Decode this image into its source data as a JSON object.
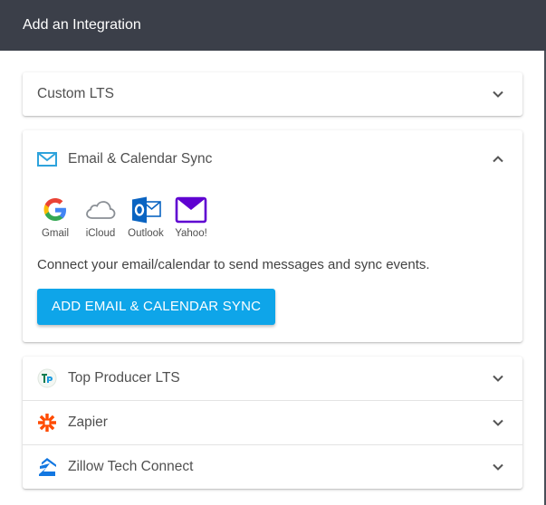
{
  "dialog": {
    "title": "Add an Integration"
  },
  "panels": {
    "custom": {
      "label": "Custom LTS"
    },
    "email": {
      "label": "Email & Calendar Sync",
      "providers": [
        {
          "name": "Gmail",
          "icon": "gmail-icon"
        },
        {
          "name": "iCloud",
          "icon": "icloud-icon"
        },
        {
          "name": "Outlook",
          "icon": "outlook-icon"
        },
        {
          "name": "Yahoo!",
          "icon": "yahoo-icon"
        }
      ],
      "description": "Connect your email/calendar to send messages and sync events.",
      "button_label": "ADD EMAIL & CALENDAR SYNC"
    },
    "top_producer": {
      "label": "Top Producer LTS"
    },
    "zapier": {
      "label": "Zapier"
    },
    "zillow": {
      "label": "Zillow Tech Connect"
    }
  },
  "colors": {
    "header_bg": "#3b3f49",
    "accent": "#0ea5e9",
    "zapier": "#ff4a00",
    "zillow": "#1277e1"
  }
}
